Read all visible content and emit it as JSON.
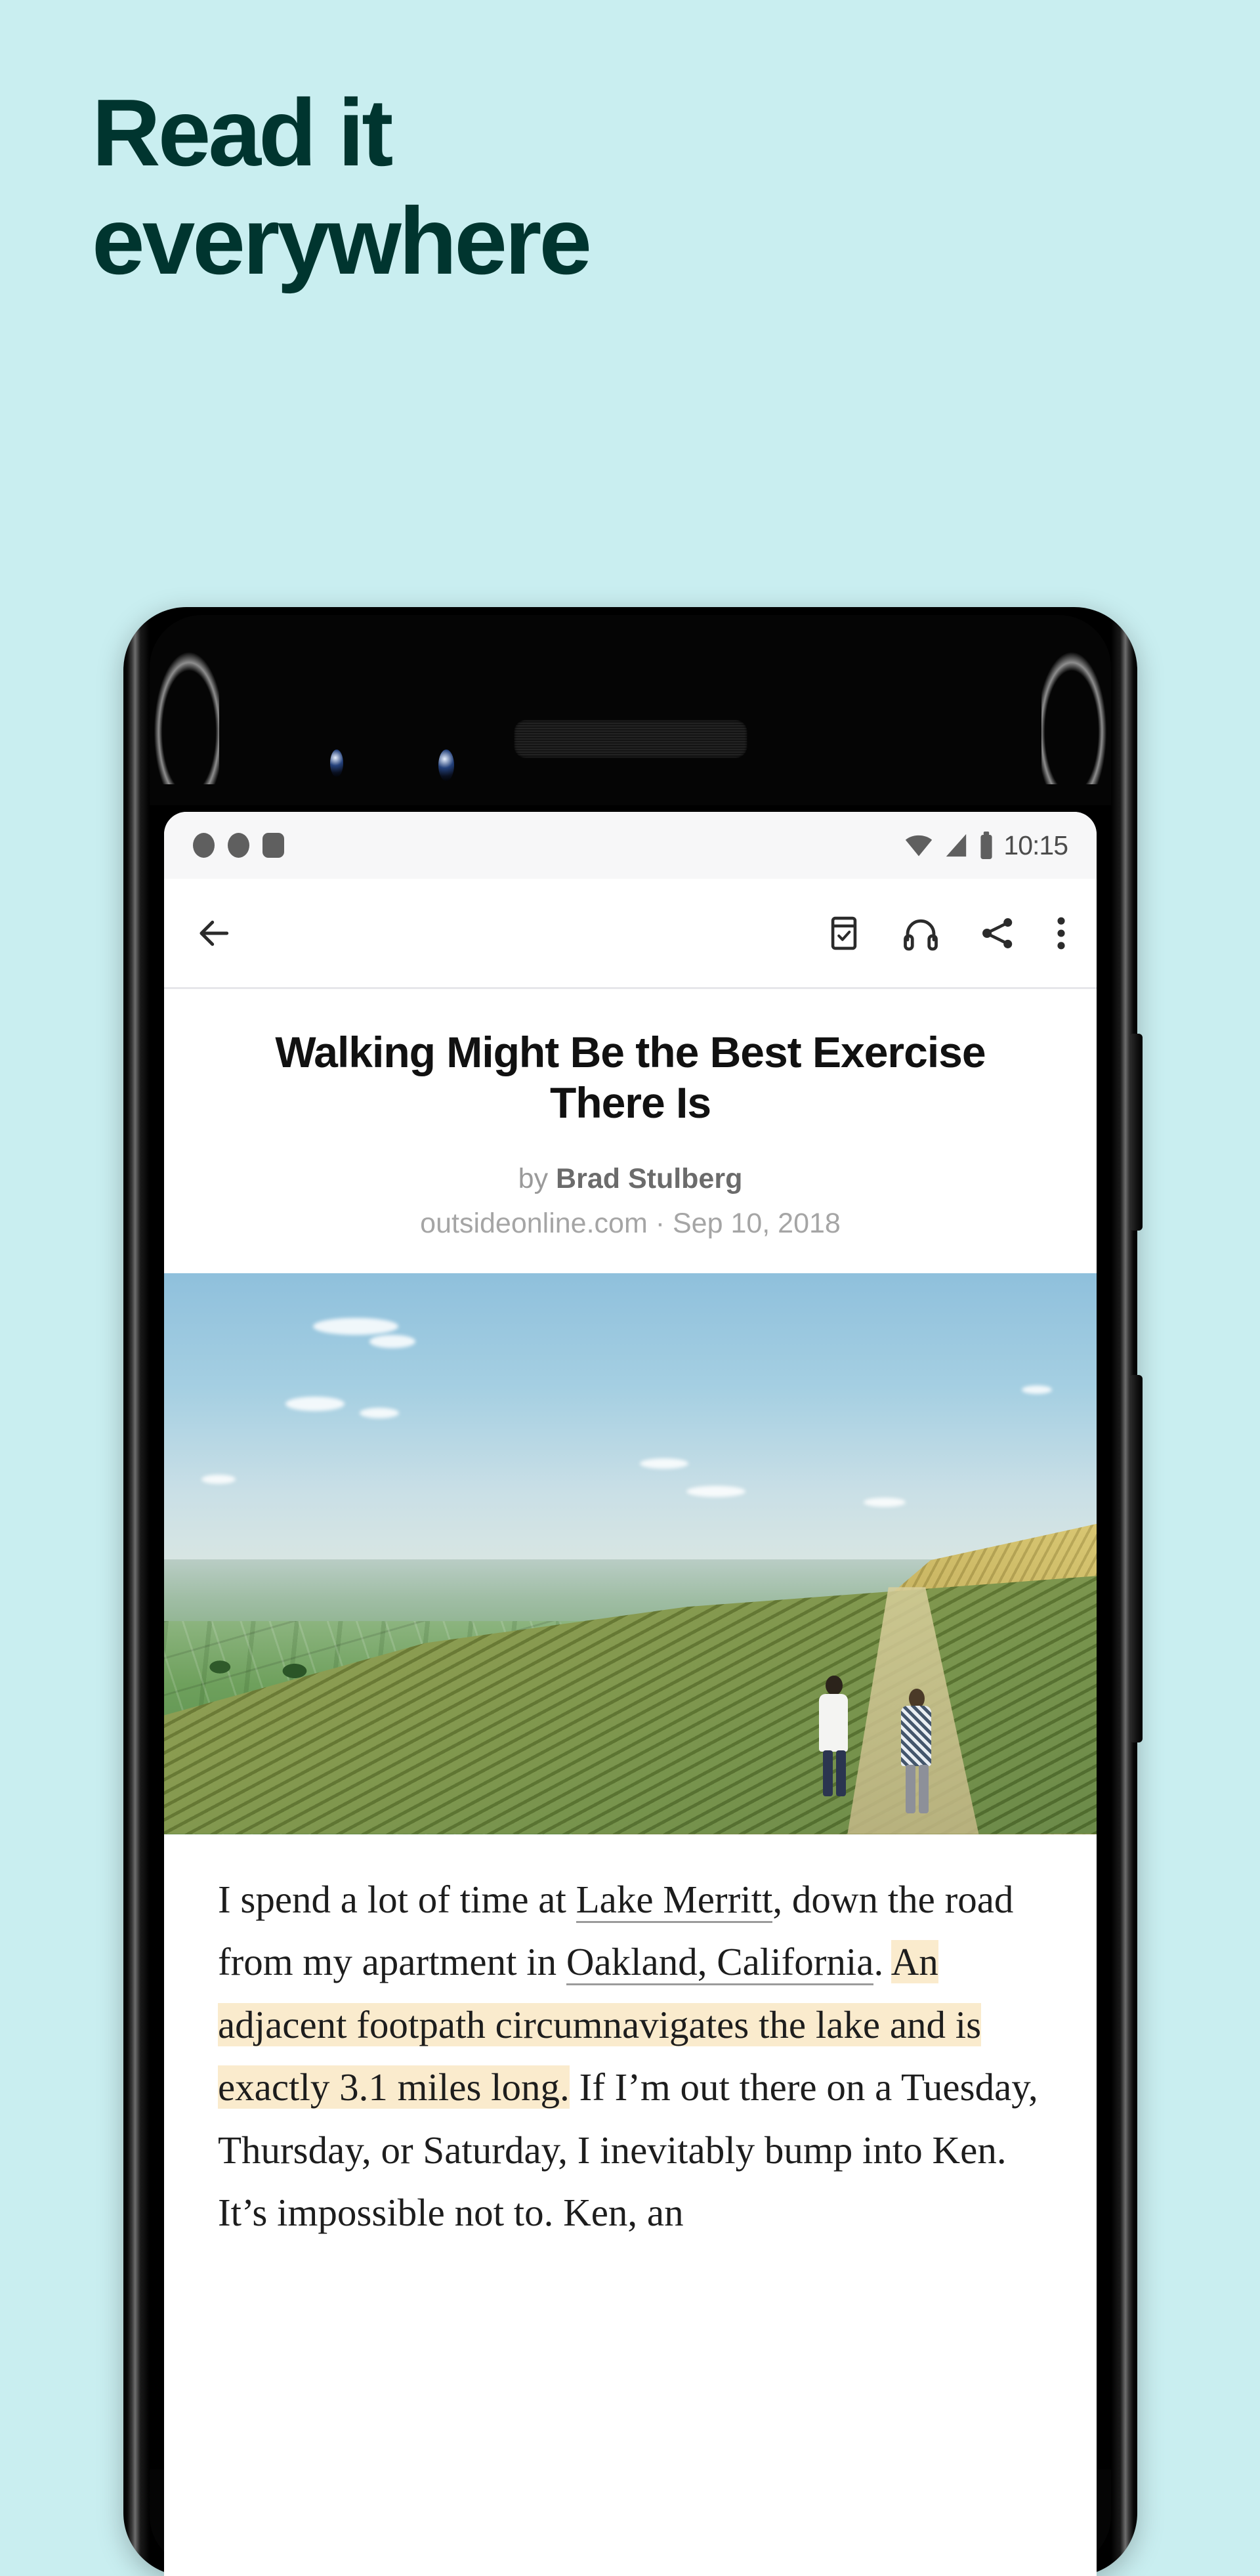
{
  "theme": {
    "background": "#c9eef0",
    "headline_color": "#00352f",
    "highlight_color": "#faebcd",
    "link_underline": "#9b9b9b"
  },
  "promo": {
    "line1": "Read it",
    "line2": "everywhere"
  },
  "phone": {
    "buttons": {
      "power": "power-button",
      "volume": "volume-rocker"
    },
    "hardware": {
      "earpiece": "earpiece-speaker",
      "camera_1": "front-camera-1",
      "camera_2": "front-camera-2"
    }
  },
  "status_bar": {
    "notifications": [
      "notification-dot-1",
      "notification-dot-2",
      "notification-square"
    ],
    "wifi": "wifi-icon",
    "signal": "cell-signal-icon",
    "battery": "battery-icon",
    "time": "10:15"
  },
  "toolbar": {
    "back": "back-arrow-icon",
    "archive": "archive-icon",
    "listen": "headphones-icon",
    "share": "share-icon",
    "more": "overflow-menu-icon"
  },
  "article": {
    "title": "Walking Might Be the Best Exercise There Is",
    "by_prefix": "by ",
    "author": "Brad Stulberg",
    "source": "outsideonline.com · Sep 10, 2018",
    "hero_image_alt": "Two hikers walking a grassy ridge trail above patchwork farmland",
    "body": {
      "seg1": "I spend a lot of time at ",
      "link1": "Lake Merritt",
      "seg2": ", down the road from my apartment in ",
      "link2": "Oakland, California",
      "seg3": ". ",
      "highlight": "An adjacent footpath circumnavigates the lake and is exactly 3.1 miles long.",
      "seg4": " If I’m out there on a Tuesday, Thursday, or Saturday, I inevitably bump into Ken. It’s impossible not to. Ken, an"
    }
  }
}
